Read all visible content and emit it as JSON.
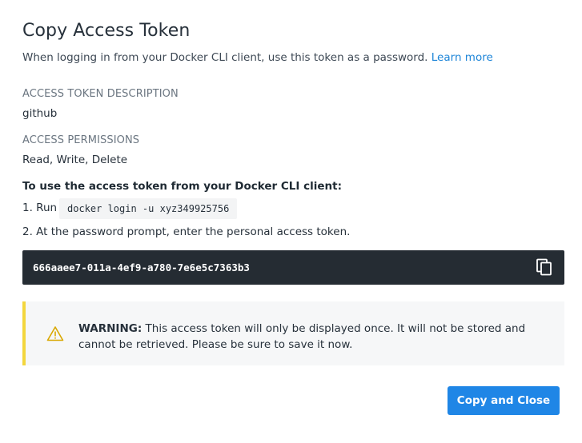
{
  "dialog": {
    "title": "Copy Access Token",
    "subtitle": "When logging in from your Docker CLI client, use this token as a password.",
    "learn_more": "Learn more"
  },
  "fields": {
    "description_label": "ACCESS TOKEN DESCRIPTION",
    "description_value": "github",
    "permissions_label": "ACCESS PERMISSIONS",
    "permissions_value": "Read, Write, Delete"
  },
  "instructions": {
    "heading": "To use the access token from your Docker CLI client:",
    "step1_prefix": "1. Run",
    "step1_command": "docker login -u xyz349925756",
    "step2": "2. At the password prompt, enter the personal access token."
  },
  "token": {
    "value": "666aaee7-011a-4ef9-a780-7e6e5c7363b3",
    "copy_icon": "copy-icon"
  },
  "warning": {
    "icon": "warning-icon",
    "label": "WARNING:",
    "message": "This access token will only be displayed once. It will not be stored and cannot be retrieved. Please be sure to save it now.",
    "accent_color": "#f3d63d"
  },
  "actions": {
    "primary_label": "Copy and Close",
    "primary_color": "#1f86e6"
  }
}
